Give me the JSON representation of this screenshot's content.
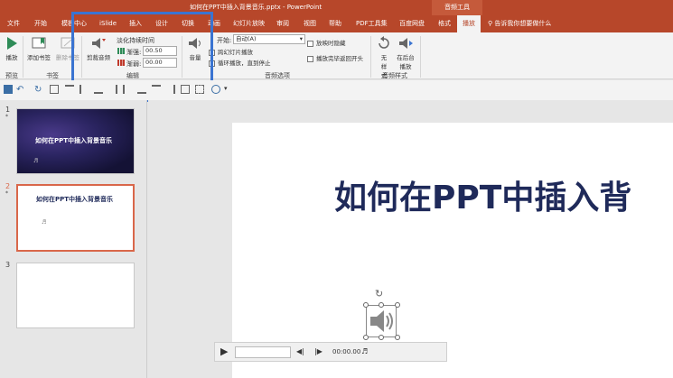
{
  "window": {
    "title": "如何在PPT中插入背景音乐.pptx  -  PowerPoint",
    "context_tab": "音频工具"
  },
  "tabs": [
    "文件",
    "开始",
    "模板中心",
    "iSlide",
    "插入",
    "设计",
    "切换",
    "动画",
    "幻灯片放映",
    "审阅",
    "视图",
    "帮助",
    "PDF工具集",
    "百度网盘",
    "格式",
    "播放"
  ],
  "tell_me": "告诉我你想要做什么",
  "ribbon": {
    "preview": {
      "play_label": "播放",
      "group": "预览"
    },
    "bookmarks": {
      "add_label": "添加书签",
      "remove_label": "删除书签",
      "group": "书签"
    },
    "editing": {
      "trim_label": "剪裁音频",
      "fade_title": "淡化持续时间",
      "fade_in_label": "渐强:",
      "fade_in_value": "00.50",
      "fade_out_label": "渐弱:",
      "fade_out_value": "00.00",
      "group": "编辑"
    },
    "audio_options": {
      "volume_label": "音量",
      "start_label": "开始:",
      "start_value": "自动(A)",
      "cross_slides": "跨幻灯片播放",
      "loop": "循环播放，直到停止",
      "hide": "放映时隐藏",
      "rewind": "播放完毕返回开头",
      "group": "音频选项"
    },
    "audio_styles": {
      "none_label": "无样式",
      "background_label": "在后台播放",
      "group": "音频样式"
    }
  },
  "slides": [
    {
      "number": "1",
      "star": "*",
      "title": "如何在PPT中插入背景音乐"
    },
    {
      "number": "2",
      "star": "*",
      "title": "如何在PPT中插入背景音乐"
    },
    {
      "number": "3"
    }
  ],
  "slide_main": {
    "title": "如何在PPT中插入背"
  },
  "player": {
    "time": "00:00.00"
  },
  "colors": {
    "accent": "#b7472a",
    "highlight": "#3a74d1",
    "slide_title": "#1f2a5a"
  }
}
